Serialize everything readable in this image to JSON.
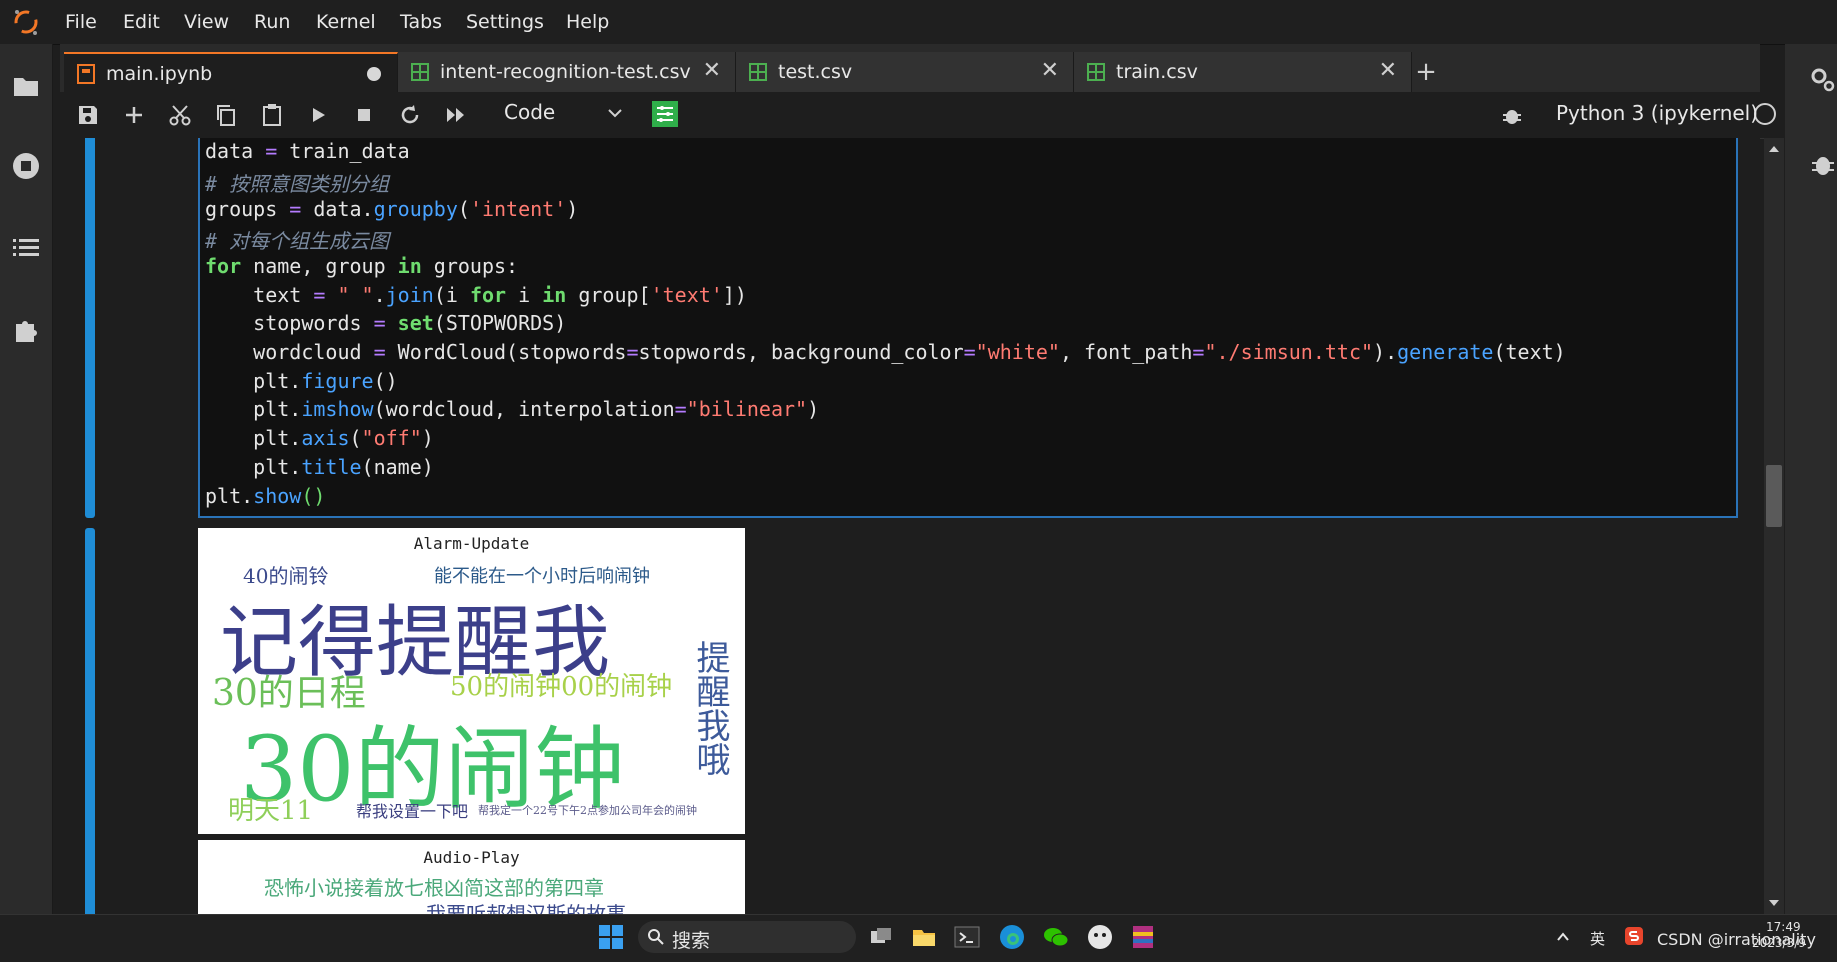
{
  "menu": [
    "File",
    "Edit",
    "View",
    "Run",
    "Kernel",
    "Tabs",
    "Settings",
    "Help"
  ],
  "tabs": [
    {
      "label": "main.ipynb",
      "active": true
    },
    {
      "label": "intent-recognition-test.csv",
      "active": false
    },
    {
      "label": "test.csv",
      "active": false
    },
    {
      "label": "train.csv",
      "active": false
    }
  ],
  "toolbar": {
    "cell_type": "Code",
    "kernel": "Python 3 (ipykernel)"
  },
  "code": {
    "l1": {
      "a": "data",
      "b": " = ",
      "c": "train_data"
    },
    "l2": "# 按照意图类别分组",
    "l3": {
      "a": "groups",
      "b": " = ",
      "c": "data.",
      "d": "groupby",
      "e": "(",
      "f": "'intent'",
      "g": ")"
    },
    "l4": "# 对每个组生成云图",
    "l5": {
      "a": "for",
      "b": " name, group ",
      "c": "in",
      "d": " groups:"
    },
    "l6": {
      "a": "    text ",
      "b": "=",
      "c": " ",
      "d": "\" \"",
      "e": ".",
      "f": "join",
      "g": "(i ",
      "h": "for",
      "i": " i ",
      "j": "in",
      "k": " group[",
      "l": "'text'",
      "m": "])"
    },
    "l7": {
      "a": "    stopwords ",
      "b": "=",
      "c": " ",
      "d": "set",
      "e": "(STOPWORDS)"
    },
    "l8": {
      "a": "    wordcloud ",
      "b": "=",
      "c": " WordCloud(stopwords",
      "d": "=",
      "e": "stopwords, background_color",
      "f": "=",
      "g": "\"white\"",
      "h": ", font_path",
      "i": "=",
      "j": "\"./simsun.ttc\"",
      "k": ").",
      "l": "generate",
      "m": "(text)"
    },
    "l9": {
      "a": "    plt.",
      "b": "figure",
      "c": "()"
    },
    "l10": {
      "a": "    plt.",
      "b": "imshow",
      "c": "(wordcloud, interpolation",
      "d": "=",
      "e": "\"bilinear\"",
      "f": ")"
    },
    "l11": {
      "a": "    plt.",
      "b": "axis",
      "c": "(",
      "d": "\"off\"",
      "e": ")"
    },
    "l12": {
      "a": "    plt.",
      "b": "title",
      "c": "(name)"
    },
    "l13": {
      "a": "plt.",
      "b": "show",
      "c": "()"
    }
  },
  "outputs": [
    {
      "title": "Alarm-Update",
      "words": [
        {
          "text": "40的闹铃",
          "color": "#3b4a8c"
        },
        {
          "text": "能不能在一个小时后响闹钟",
          "color": "#2c5a8a"
        },
        {
          "text": "记得提醒我",
          "color": "#3c3f8a"
        },
        {
          "text": "30的日程",
          "color": "#6bbf59"
        },
        {
          "text": "50的闹钟00的闹钟",
          "color": "#a8d14a"
        },
        {
          "text": "30的闹钟",
          "color": "#3ec26a"
        },
        {
          "text": "提醒我哦",
          "color": "#3d5a9a"
        },
        {
          "text": "明天11",
          "color": "#8fcf5a"
        },
        {
          "text": "帮我设置一下吧",
          "color": "#3b3f80"
        },
        {
          "text": "帮我定一个22号下午2点参加公司年会的闹钟",
          "color": "#5a5a8a"
        }
      ]
    },
    {
      "title": "Audio-Play",
      "words": [
        {
          "text": "恐怖小说接着放七根凶简这部的第四章",
          "color": "#4aa87a"
        },
        {
          "text": "我要听郝想汉斯的故事",
          "color": "#3b4a8c"
        }
      ]
    }
  ],
  "taskbar": {
    "search": "搜索",
    "lang": "英",
    "time": "17:49",
    "date": "2023/3/9",
    "watermark": "CSDN @irrationality"
  },
  "colors": {
    "accent": "#f37726",
    "cell_selected": "#1f8dd6",
    "code_keyword": "#6fdc6f",
    "code_function": "#4aa3ff",
    "code_string": "#ff7b72"
  }
}
